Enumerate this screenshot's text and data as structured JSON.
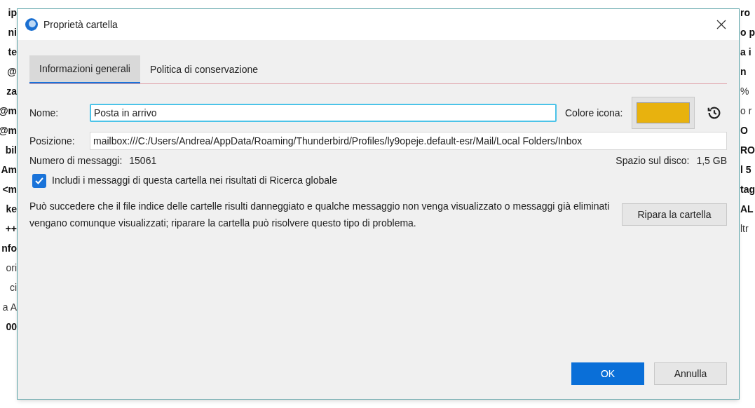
{
  "background": {
    "left_fragments": [
      {
        "text": "ip",
        "bold": true
      },
      {
        "text": "ni",
        "bold": true
      },
      {
        "text": "te",
        "bold": true
      },
      {
        "text": "@",
        "bold": true
      },
      {
        "text": "za",
        "bold": true
      },
      {
        "text": "@m",
        "bold": true
      },
      {
        "text": "@m",
        "bold": true
      },
      {
        "text": "bil",
        "bold": true
      },
      {
        "text": "Am",
        "bold": true
      },
      {
        "text": "<m",
        "bold": true
      },
      {
        "text": "ke",
        "bold": true
      },
      {
        "text": "++",
        "bold": true
      },
      {
        "text": "nfo",
        "bold": true
      },
      {
        "text": "ori",
        "bold": false
      },
      {
        "text": "ci",
        "bold": false
      },
      {
        "text": "a A",
        "bold": false
      },
      {
        "text": "00",
        "bold": true
      }
    ],
    "right_fragments": [
      {
        "text": "ro",
        "bold": true
      },
      {
        "text": "o p",
        "bold": true
      },
      {
        "text": "a i",
        "bold": true
      },
      {
        "text": "n",
        "bold": true
      },
      {
        "text": "%",
        "bold": false
      },
      {
        "text": "o r",
        "bold": false
      },
      {
        "text": "O",
        "bold": true
      },
      {
        "text": "RO",
        "bold": true
      },
      {
        "text": "l 5",
        "bold": true
      },
      {
        "text": "tag",
        "bold": true
      },
      {
        "text": "AL",
        "bold": true
      },
      {
        "text": "ltr",
        "bold": false
      }
    ]
  },
  "window": {
    "title": "Proprietà cartella"
  },
  "tabs": [
    {
      "label": "Informazioni generali",
      "selected": true
    },
    {
      "label": "Politica di conservazione",
      "selected": false
    }
  ],
  "name_field": {
    "label": "Nome:",
    "value": "Posta in arrivo"
  },
  "icon_color": {
    "label": "Colore icona:",
    "color": "#e8b20e"
  },
  "location_field": {
    "label": "Posizione:",
    "value": "mailbox:///C:/Users/Andrea/AppData/Roaming/Thunderbird/Profiles/ly9opeje.default-esr/Mail/Local Folders/Inbox"
  },
  "message_count": {
    "label": "Numero di messaggi:",
    "value": "15061"
  },
  "disk_space": {
    "label": "Spazio sul disco:",
    "value": "1,5 GB"
  },
  "global_search": {
    "label": "Includi i messaggi di questa cartella nei risultati di Ricerca globale",
    "checked": true
  },
  "repair": {
    "description": "Può succedere che il file indice delle cartelle risulti danneggiato e qualche messaggio non venga visualizzato o messaggi già eliminati vengano comunque visualizzati; riparare la cartella può risolvere questo tipo di problema.",
    "button": "Ripara la cartella"
  },
  "buttons": [
    {
      "label": "OK",
      "primary": true
    },
    {
      "label": "Annulla",
      "primary": false
    }
  ]
}
